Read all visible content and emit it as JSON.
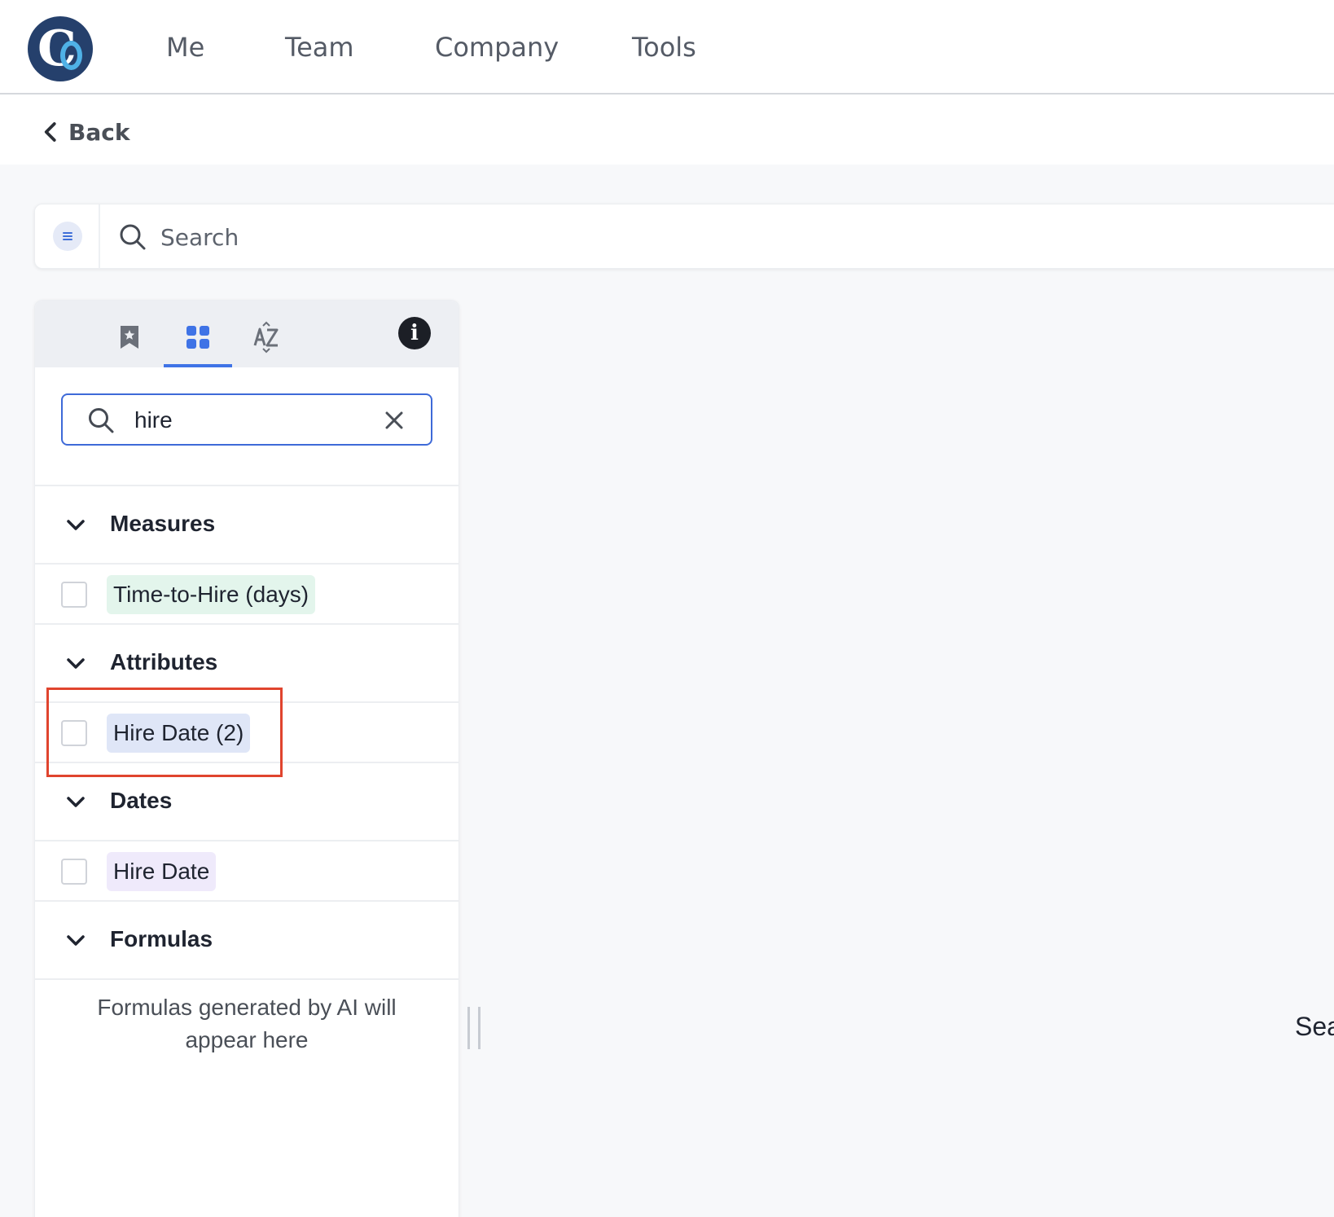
{
  "nav": {
    "items": [
      {
        "label": "Me"
      },
      {
        "label": "Team"
      },
      {
        "label": "Company"
      },
      {
        "label": "Tools"
      }
    ]
  },
  "back": {
    "label": "Back"
  },
  "global_search": {
    "placeholder": "Search"
  },
  "panel": {
    "tabs": [
      {
        "icon": "bookmark-star-icon",
        "active": false
      },
      {
        "icon": "grid-icon",
        "active": true
      },
      {
        "icon": "sort-az-icon",
        "active": false
      }
    ],
    "info_icon": "info-icon",
    "info_label": "i",
    "field_search": {
      "value": "hire",
      "placeholder": ""
    },
    "sections": [
      {
        "title": "Measures",
        "items": [
          {
            "label": "Time-to-Hire (days)",
            "kind": "measure"
          }
        ]
      },
      {
        "title": "Attributes",
        "items": [
          {
            "label": "Hire Date (2)",
            "kind": "attr"
          }
        ]
      },
      {
        "title": "Dates",
        "items": [
          {
            "label": "Hire Date",
            "kind": "date"
          }
        ]
      },
      {
        "title": "Formulas",
        "items": []
      }
    ],
    "formulas_empty": "Formulas generated by AI will appear here"
  },
  "right_peek": "Sea",
  "colors": {
    "accent": "#3f73e6",
    "logo_bg": "#25406c",
    "measure_pill": "#e3f5ec",
    "attribute_pill": "#dfe6f7",
    "date_pill": "#efeafb",
    "highlight": "#e0442e"
  }
}
